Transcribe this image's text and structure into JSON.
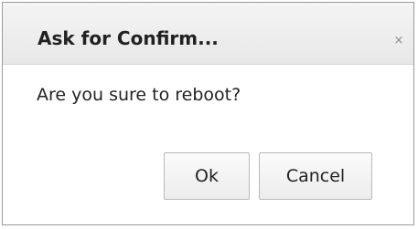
{
  "dialog": {
    "title": "Ask for Confirm...",
    "close_icon": "close-icon",
    "close_glyph": "×",
    "message": "Are you sure to reboot?",
    "buttons": {
      "ok_label": "Ok",
      "cancel_label": "Cancel"
    }
  }
}
